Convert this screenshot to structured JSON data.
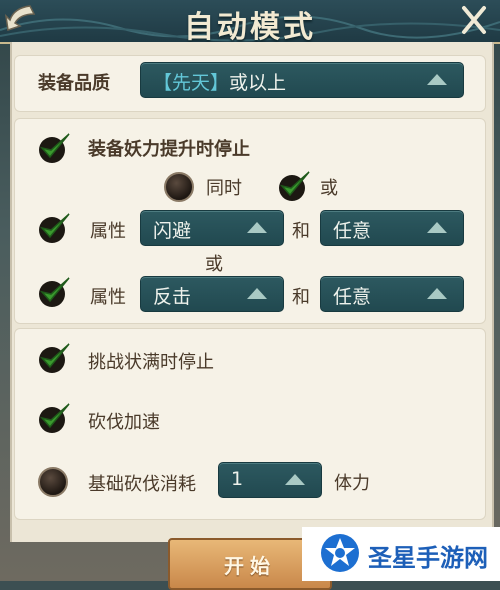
{
  "header": {
    "title": "自动模式"
  },
  "quality": {
    "label": "装备品质",
    "bracket_open": "【",
    "value": "先天",
    "bracket_close": "】",
    "suffix": "或以上"
  },
  "stop_on_upgrade": {
    "label": "装备妖力提升时停止",
    "checked": true
  },
  "logic": {
    "both_label": "同时",
    "both_selected": false,
    "or_label": "或",
    "or_selected": true
  },
  "attr_row1": {
    "label": "属性",
    "value1": "闪避",
    "conj": "和",
    "value2": "任意",
    "checked": true
  },
  "attr_or": "或",
  "attr_row2": {
    "label": "属性",
    "value1": "反击",
    "conj": "和",
    "value2": "任意",
    "checked": true
  },
  "stop_on_full": {
    "label": "挑战状满时停止",
    "checked": true
  },
  "chop_speed": {
    "label": "砍伐加速",
    "checked": true
  },
  "base_cost": {
    "label": "基础砍伐消耗",
    "value": "1",
    "unit": "体力",
    "checked": false
  },
  "start_button": {
    "label": "开始"
  },
  "watermark": {
    "text": "圣星手游网"
  },
  "colors": {
    "header": "#1f3a44",
    "dropdown": "#2d5960",
    "check": "#2f8a2a",
    "panel": "#ece6d6"
  },
  "icons": {
    "back": "back-arrow-icon",
    "close": "close-x-icon",
    "check": "checkmark-icon"
  }
}
